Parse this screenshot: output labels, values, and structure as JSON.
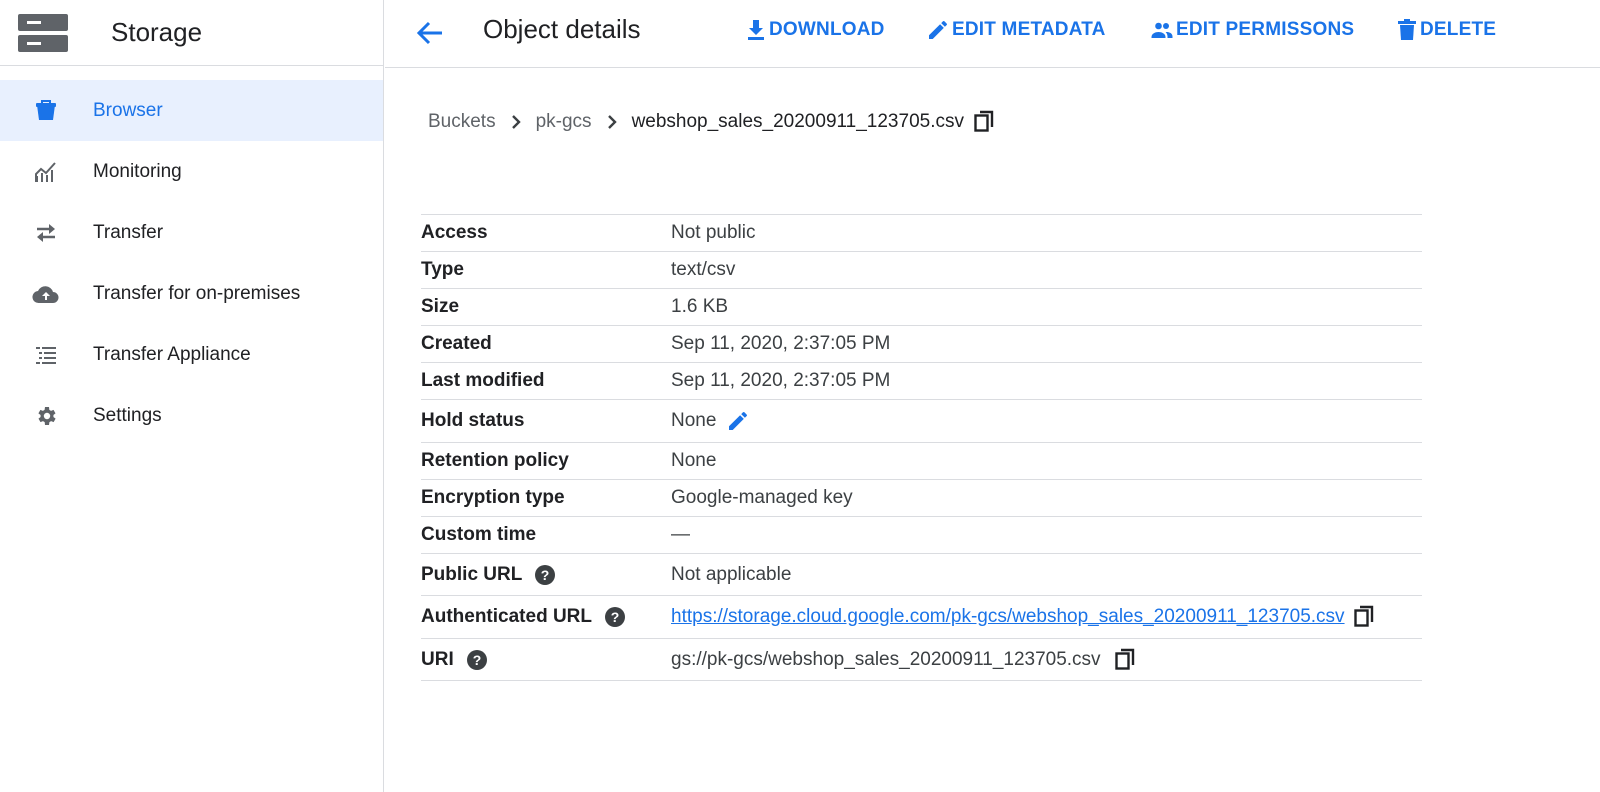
{
  "app": {
    "title": "Storage",
    "logo_icon": "storage-icon"
  },
  "sidebar": {
    "items": [
      {
        "label": "Browser",
        "icon": "bucket-icon",
        "active": true
      },
      {
        "label": "Monitoring",
        "icon": "chart-icon",
        "active": false
      },
      {
        "label": "Transfer",
        "icon": "swap-icon",
        "active": false
      },
      {
        "label": "Transfer for on-premises",
        "icon": "cloud-upload-icon",
        "active": false
      },
      {
        "label": "Transfer Appliance",
        "icon": "list-icon",
        "active": false
      },
      {
        "label": "Settings",
        "icon": "gear-icon",
        "active": false
      }
    ]
  },
  "header": {
    "title": "Object details",
    "actions": {
      "download": "DOWNLOAD",
      "edit_metadata": "EDIT METADATA",
      "edit_permissions": "EDIT PERMISSONS",
      "delete": "DELETE"
    }
  },
  "breadcrumb": {
    "items": [
      "Buckets",
      "pk-gcs",
      "webshop_sales_20200911_123705.csv"
    ]
  },
  "details": {
    "rows": [
      {
        "label": "Access",
        "value": "Not public"
      },
      {
        "label": "Type",
        "value": "text/csv"
      },
      {
        "label": "Size",
        "value": "1.6 KB"
      },
      {
        "label": "Created",
        "value": "Sep 11, 2020, 2:37:05 PM"
      },
      {
        "label": "Last modified",
        "value": "Sep 11, 2020, 2:37:05 PM"
      },
      {
        "label": "Hold status",
        "value": "None"
      },
      {
        "label": "Retention policy",
        "value": "None"
      },
      {
        "label": "Encryption type",
        "value": "Google-managed key"
      },
      {
        "label": "Custom time",
        "value": "—"
      },
      {
        "label": "Public URL",
        "value": "Not applicable"
      },
      {
        "label": "Authenticated URL",
        "value": "https://storage.cloud.google.com/pk-gcs/webshop_sales_20200911_123705.csv"
      },
      {
        "label": "URI",
        "value": "gs://pk-gcs/webshop_sales_20200911_123705.csv"
      }
    ]
  },
  "colors": {
    "accent": "#1a73e8",
    "active_bg": "#e8f0fe",
    "icon_gray": "#5f6368",
    "divider": "#dadce0"
  }
}
